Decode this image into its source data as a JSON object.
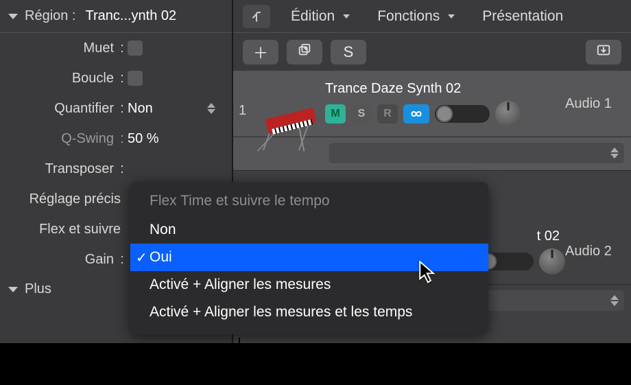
{
  "sidebar": {
    "header_label": "Région :",
    "header_value": "Tranc...ynth 02",
    "rows": {
      "muet": "Muet",
      "boucle": "Boucle",
      "quantifier": "Quantifier",
      "quantifier_value": "Non",
      "qswing": "Q-Swing",
      "qswing_value": "50 %",
      "transposer": "Transposer",
      "reglage": "Réglage précis",
      "flex": "Flex et suivre",
      "gain": "Gain"
    },
    "plus": "Plus"
  },
  "topbar": {
    "edition": "Édition",
    "fonctions": "Fonctions",
    "presentation": "Présentation"
  },
  "toolbar": {
    "solo": "S"
  },
  "tracks": [
    {
      "num": "1",
      "name": "Trance Daze Synth 02",
      "audio": "Audio 1",
      "m": "M",
      "s": "S",
      "r": "R"
    },
    {
      "num": "",
      "name": "t 02",
      "audio": "Audio 2",
      "m": "",
      "s": "",
      "r": ""
    }
  ],
  "popup": {
    "title": "Flex Time et suivre le tempo",
    "items": [
      "Non",
      "Oui",
      "Activé + Aligner les mesures",
      "Activé + Aligner les mesures et les temps"
    ],
    "selected_index": 1
  }
}
